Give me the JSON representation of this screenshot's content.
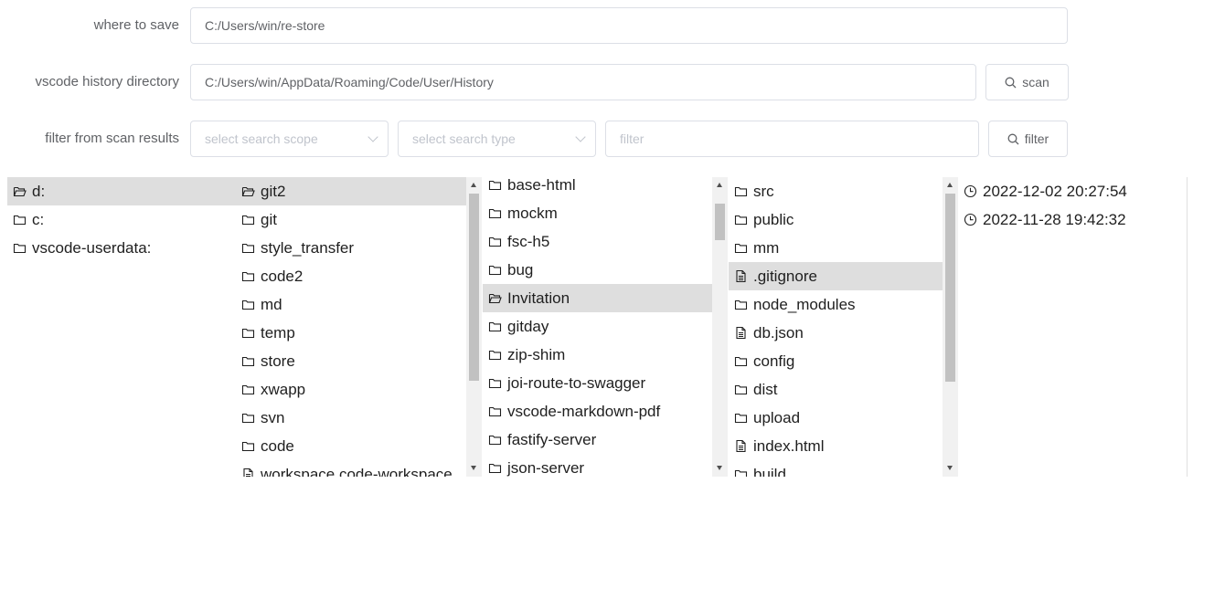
{
  "form": {
    "save": {
      "label": "where to save",
      "value": "C:/Users/win/re-store"
    },
    "history": {
      "label": "vscode history directory",
      "value": "C:/Users/win/AppData/Roaming/Code/User/History",
      "scan_label": "scan"
    },
    "filter": {
      "label": "filter from scan results",
      "scope_placeholder": "select search scope",
      "type_placeholder": "select search type",
      "filter_placeholder": "filter",
      "filter_button": "filter"
    }
  },
  "columns": {
    "drives": [
      {
        "name": "d:",
        "type": "folder-open",
        "selected": true
      },
      {
        "name": "c:",
        "type": "folder",
        "selected": false
      },
      {
        "name": "vscode-userdata:",
        "type": "folder",
        "selected": false
      }
    ],
    "level1": [
      {
        "name": "git2",
        "type": "folder-open",
        "selected": true
      },
      {
        "name": "git",
        "type": "folder",
        "selected": false
      },
      {
        "name": "style_transfer",
        "type": "folder",
        "selected": false
      },
      {
        "name": "code2",
        "type": "folder",
        "selected": false
      },
      {
        "name": "md",
        "type": "folder",
        "selected": false
      },
      {
        "name": "temp",
        "type": "folder",
        "selected": false
      },
      {
        "name": "store",
        "type": "folder",
        "selected": false
      },
      {
        "name": "xwapp",
        "type": "folder",
        "selected": false
      },
      {
        "name": "svn",
        "type": "folder",
        "selected": false
      },
      {
        "name": "code",
        "type": "folder",
        "selected": false
      },
      {
        "name": "workspace.code-workspace",
        "type": "file",
        "selected": false
      }
    ],
    "level2": [
      {
        "name": "base-html",
        "type": "folder",
        "selected": false
      },
      {
        "name": "mockm",
        "type": "folder",
        "selected": false
      },
      {
        "name": "fsc-h5",
        "type": "folder",
        "selected": false
      },
      {
        "name": "bug",
        "type": "folder",
        "selected": false
      },
      {
        "name": "Invitation",
        "type": "folder-open",
        "selected": true
      },
      {
        "name": "gitday",
        "type": "folder",
        "selected": false
      },
      {
        "name": "zip-shim",
        "type": "folder",
        "selected": false
      },
      {
        "name": "joi-route-to-swagger",
        "type": "folder",
        "selected": false
      },
      {
        "name": "vscode-markdown-pdf",
        "type": "folder",
        "selected": false
      },
      {
        "name": "fastify-server",
        "type": "folder",
        "selected": false
      },
      {
        "name": "json-server",
        "type": "folder",
        "selected": false
      }
    ],
    "level3": [
      {
        "name": "src",
        "type": "folder",
        "selected": false
      },
      {
        "name": "public",
        "type": "folder",
        "selected": false
      },
      {
        "name": "mm",
        "type": "folder",
        "selected": false
      },
      {
        "name": ".gitignore",
        "type": "file",
        "selected": true
      },
      {
        "name": "node_modules",
        "type": "folder",
        "selected": false
      },
      {
        "name": "db.json",
        "type": "file",
        "selected": false
      },
      {
        "name": "config",
        "type": "folder",
        "selected": false
      },
      {
        "name": "dist",
        "type": "folder",
        "selected": false
      },
      {
        "name": "upload",
        "type": "folder",
        "selected": false
      },
      {
        "name": "index.html",
        "type": "file",
        "selected": false
      },
      {
        "name": "build",
        "type": "folder",
        "selected": false
      }
    ],
    "history": [
      {
        "name": "2022-12-02 20:27:54",
        "type": "clock",
        "selected": false
      },
      {
        "name": "2022-11-28 19:42:32",
        "type": "clock",
        "selected": false
      }
    ]
  },
  "icons": {
    "scan": "search-icon",
    "filter": "search-icon",
    "select_caret": "chevron-down-icon",
    "folder": "folder-icon",
    "folder_open": "folder-open-icon",
    "file": "file-icon",
    "clock": "clock-icon"
  }
}
